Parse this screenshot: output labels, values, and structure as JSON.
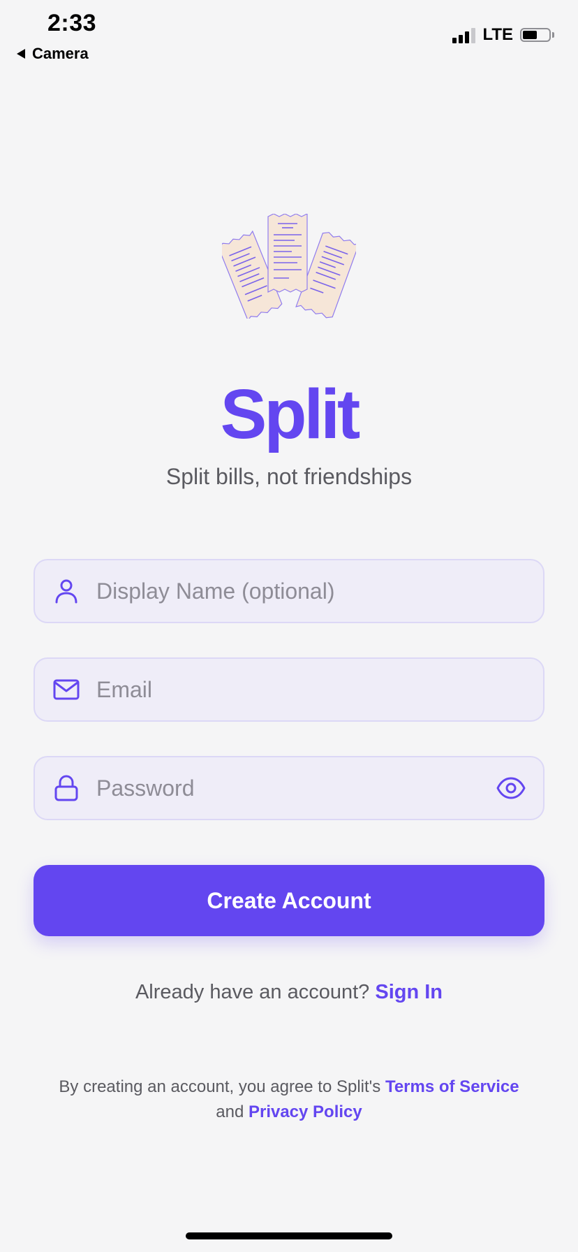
{
  "status_bar": {
    "time": "2:33",
    "back_app": "Camera",
    "network": "LTE",
    "battery_level": 0.55
  },
  "colors": {
    "accent": "#6346f0",
    "field_background": "#efedf8",
    "page_background": "#f5f5f6"
  },
  "app": {
    "title": "Split",
    "tagline": "Split bills, not friendships",
    "illustration_icon": "receipts-illustration"
  },
  "form": {
    "display_name": {
      "placeholder": "Display Name (optional)",
      "value": "",
      "icon": "user-icon"
    },
    "email": {
      "placeholder": "Email",
      "value": "",
      "icon": "mail-icon"
    },
    "password": {
      "placeholder": "Password",
      "value": "",
      "icon": "lock-icon",
      "toggle_icon": "eye-icon"
    },
    "submit_label": "Create Account"
  },
  "signin": {
    "prompt": "Already have an account?",
    "link": "Sign In"
  },
  "legal": {
    "prefix": "By creating an account, you agree to Split's",
    "terms": "Terms of Service",
    "conjunction": "and",
    "privacy": "Privacy Policy"
  }
}
